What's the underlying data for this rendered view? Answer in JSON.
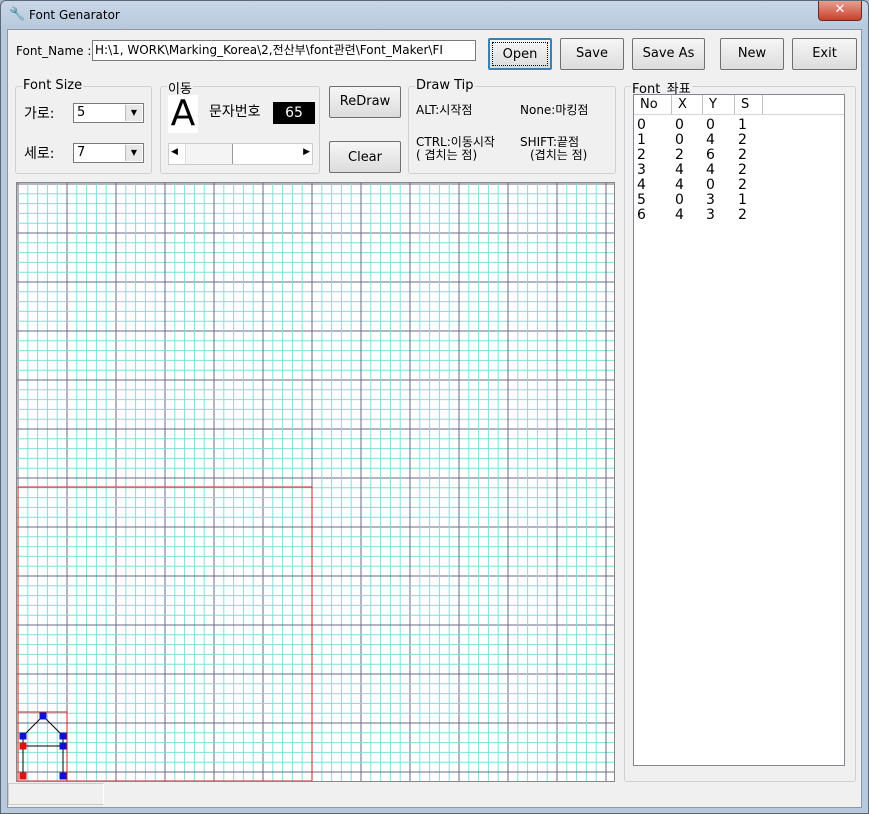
{
  "window": {
    "title": "Font Genarator",
    "close": "✕",
    "app_icon": "wrench-icon"
  },
  "font_name": {
    "label": "Font_Name :",
    "value": "H:\\1, WORK\\Marking_Korea\\2,전산부\\font관련\\Font_Maker\\FI"
  },
  "buttons": {
    "open": "Open",
    "save": "Save",
    "save_as": "Save As",
    "new": "New",
    "exit": "Exit",
    "redraw": "ReDraw",
    "clear": "Clear"
  },
  "font_size": {
    "title": "Font Size",
    "width_label": "가로:",
    "width_value": "5",
    "height_label": "세로:",
    "height_value": "7"
  },
  "move": {
    "title": "이동",
    "char": "A",
    "char_no_label": "문자번호",
    "char_no_value": "65",
    "scroll_fraction": 0.4
  },
  "draw_tip": {
    "title": "Draw Tip",
    "alt": "ALT:시작점",
    "none": "None:마킹점",
    "ctrl": "CTRL:이동시작",
    "ctrl_sub": "( 겹치는 점)",
    "shift": "SHIFT:끝점",
    "shift_sub": "(겹치는 점)"
  },
  "coords": {
    "title": "Font_좌표",
    "columns": [
      "No",
      "X",
      "Y",
      "S"
    ],
    "rows": [
      [
        "0",
        "0",
        "0",
        "1"
      ],
      [
        "1",
        "0",
        "4",
        "2"
      ],
      [
        "2",
        "2",
        "6",
        "2"
      ],
      [
        "3",
        "4",
        "4",
        "2"
      ],
      [
        "4",
        "4",
        "0",
        "2"
      ],
      [
        "5",
        "0",
        "3",
        "1"
      ],
      [
        "6",
        "4",
        "3",
        "2"
      ]
    ]
  },
  "colors": {
    "grid_minor": "#7fe0d8",
    "grid_major": "#6a6a8a",
    "frame": "#d02020",
    "point": "#1010d0",
    "start_point": "#e01010"
  }
}
